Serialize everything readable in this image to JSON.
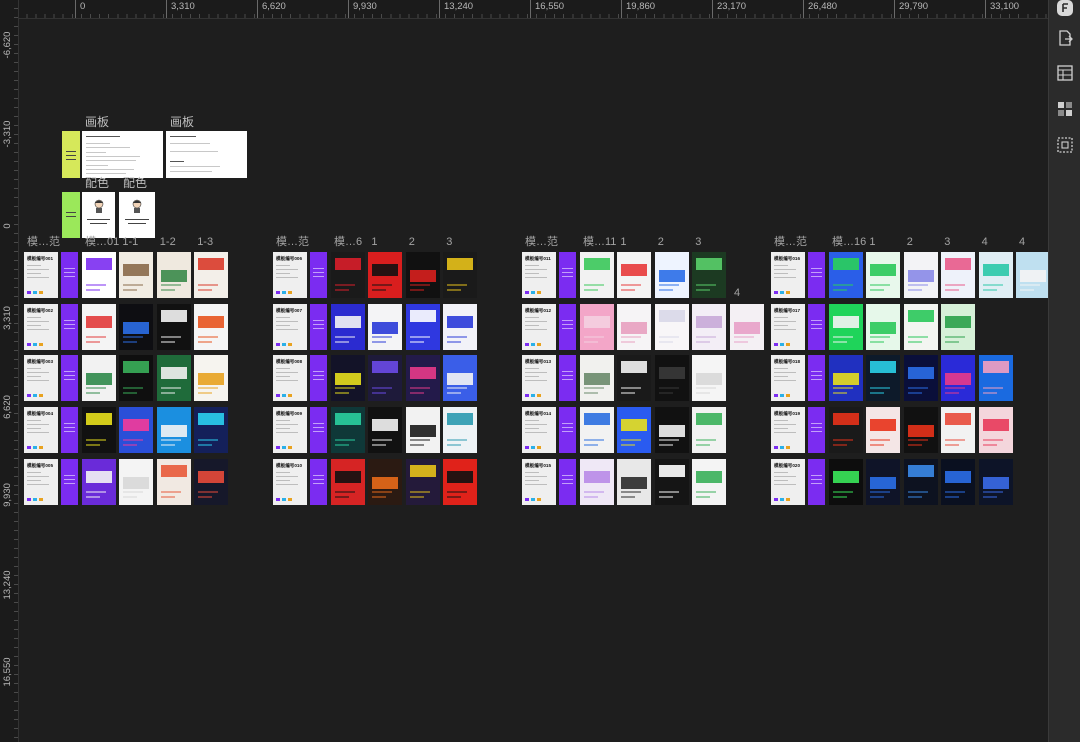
{
  "rulers": {
    "top": [
      "0",
      "3,310",
      "6,620",
      "9,930",
      "13,240",
      "16,550",
      "19,860",
      "23,170",
      "26,480",
      "29,790",
      "33,100"
    ],
    "left": [
      "-6,620",
      "-3,310",
      "0",
      "3,310",
      "6,620",
      "9,930",
      "13,240",
      "16,550"
    ]
  },
  "artboard_section": {
    "label_1": "画板",
    "label_2": "画板",
    "palette_label_1": "配色",
    "palette_label_2": "配色"
  },
  "colors": {
    "canvas": "#1e1e1e",
    "purple_bar": "#7b2cf1",
    "yellow_card": "#d6e85a",
    "green_card": "#9be85a",
    "toolbar": "#2b2b2b"
  },
  "toolbar_icons": [
    "app-logo-icon",
    "export-icon",
    "layout-icon",
    "grid-icon",
    "frame-icon"
  ],
  "groups": [
    {
      "labels": [
        "模…范",
        "模…01",
        "1-1",
        "1-2",
        "1-3"
      ],
      "rows": [
        {
          "title": "模板编号001",
          "thumbs": [
            [
              "#ffffff",
              "#7b2cf1"
            ],
            [
              "#f1ece3",
              "#8a6a4a"
            ],
            [
              "#efe9df",
              "#3a8a4a"
            ],
            [
              "#f3efe9",
              "#d93a2a"
            ]
          ]
        },
        {
          "title": "模板编号002",
          "thumbs": [
            [
              "#f4f4f4",
              "#e23a3a"
            ],
            [
              "#0e0e12",
              "#2b6ee8"
            ],
            [
              "#111111",
              "#f4f4f4"
            ],
            [
              "#f5f5f5",
              "#e8541f"
            ]
          ]
        },
        {
          "title": "模板编号003",
          "thumbs": [
            [
              "#f2f2f2",
              "#2f8a4a"
            ],
            [
              "#0f0f0f",
              "#3ab05a"
            ],
            [
              "#1f6b3a",
              "#f2f2f2"
            ],
            [
              "#f6f4ef",
              "#e8a21f"
            ]
          ]
        },
        {
          "title": "模板编号004",
          "thumbs": [
            [
              "#111111",
              "#e8e01c"
            ],
            [
              "#2a4fd8",
              "#f43a9a"
            ],
            [
              "#1b8fe0",
              "#f4f4f4"
            ],
            [
              "#14205a",
              "#2ad0f0"
            ]
          ]
        },
        {
          "title": "模板编号005",
          "thumbs": [
            [
              "#6a2bd9",
              "#f4f4f4"
            ],
            [
              "#f4f4f4",
              "#d8d8d8"
            ],
            [
              "#f1e9e2",
              "#e85a3a"
            ],
            [
              "#16182a",
              "#e84a3a"
            ]
          ]
        }
      ]
    },
    {
      "labels": [
        "模…范",
        "模…6",
        "1",
        "2",
        "3"
      ],
      "rows": [
        {
          "title": "模板编号006",
          "thumbs": [
            [
              "#1a1a1a",
              "#d91e2a"
            ],
            [
              "#d91e1e",
              "#111111"
            ],
            [
              "#111111",
              "#d8201e"
            ],
            [
              "#1a1a1a",
              "#e8c21a"
            ]
          ]
        },
        {
          "title": "模板编号007",
          "thumbs": [
            [
              "#2b2bd0",
              "#f4f4f4"
            ],
            [
              "#f4f4f6",
              "#2a3ad8"
            ],
            [
              "#2f38e0",
              "#ffffff"
            ],
            [
              "#f2f2f8",
              "#2a3ad8"
            ]
          ]
        },
        {
          "title": "模板编号008",
          "thumbs": [
            [
              "#131328",
              "#e8e01c"
            ],
            [
              "#1e1a3a",
              "#6a4ae8"
            ],
            [
              "#231a4a",
              "#e83a8a"
            ],
            [
              "#3a5ee8",
              "#f4f4f4"
            ]
          ]
        },
        {
          "title": "模板编号009",
          "thumbs": [
            [
              "#0f3838",
              "#2ad0a0"
            ],
            [
              "#111111",
              "#f4f4f4"
            ],
            [
              "#f2f2f2",
              "#1a1a1a"
            ],
            [
              "#eef3f6",
              "#2a9ab0"
            ]
          ]
        },
        {
          "title": "模板编号010",
          "thumbs": [
            [
              "#d62424",
              "#111111"
            ],
            [
              "#2b1a12",
              "#e86a1a"
            ],
            [
              "#241a3a",
              "#e8c21a"
            ],
            [
              "#e0221a",
              "#111111"
            ]
          ]
        }
      ]
    },
    {
      "labels": [
        "模…范",
        "模…11",
        "1",
        "2",
        "3"
      ],
      "rows": [
        {
          "title": "模板编号011",
          "thumbs": [
            [
              "#f2f2f2",
              "#3ac85a"
            ],
            [
              "#f4f4f4",
              "#e83a3a"
            ],
            [
              "#eef4ff",
              "#2a6ee8"
            ],
            [
              "#1c3a22",
              "#5ad06a"
            ]
          ]
        },
        {
          "title": "模板编号012",
          "extra_label": "4",
          "thumbs": [
            [
              "#f3a6c8",
              "#f4d0e0"
            ],
            [
              "#f6f4f6",
              "#e8a0c0"
            ],
            [
              "#f8f6f8",
              "#d8d8e8"
            ],
            [
              "#f3eef6",
              "#c8a8d8"
            ],
            [
              "#f4f0f4",
              "#e8a0c8"
            ]
          ]
        },
        {
          "title": "模板编号013",
          "thumbs": [
            [
              "#f1f1ee",
              "#6a8a6a"
            ],
            [
              "#1a1a1a",
              "#f4f4f4"
            ],
            [
              "#111111",
              "#3a3a3a"
            ],
            [
              "#f5f5f5",
              "#d8d8d8"
            ]
          ]
        },
        {
          "title": "模板编号014",
          "thumbs": [
            [
              "#f2f2f2",
              "#2a6ee0"
            ],
            [
              "#2a5bf0",
              "#e8e01c"
            ],
            [
              "#111111",
              "#f4f4f4"
            ],
            [
              "#f2f2f2",
              "#3ab05a"
            ]
          ]
        },
        {
          "title": "模板编号015",
          "thumbs": [
            [
              "#efe8f6",
              "#b88ae8"
            ],
            [
              "#e8e8e8",
              "#2a2a2a"
            ],
            [
              "#151515",
              "#ffffff"
            ],
            [
              "#f4f4f4",
              "#3ab05a"
            ]
          ]
        }
      ]
    },
    {
      "labels": [
        "模…范",
        "模…16",
        "1",
        "2",
        "3",
        "4",
        "4"
      ],
      "rows": [
        {
          "title": "模板编号016",
          "thumbs": [
            [
              "#2a5ee8",
              "#2ad05a"
            ],
            [
              "#e8f8ec",
              "#2ac85a"
            ],
            [
              "#f3f3f6",
              "#8a8ae8"
            ],
            [
              "#eef2fa",
              "#e85a8a"
            ],
            [
              "#e0eef4",
              "#2ac8a8"
            ],
            [
              "#bfe0f0",
              "#f4f4f4"
            ]
          ]
        },
        {
          "title": "模板编号017",
          "thumbs": [
            [
              "#1fd45a",
              "#f4f4f4"
            ],
            [
              "#e6f8ea",
              "#2ac85a"
            ],
            [
              "#f3f5f1",
              "#2ac85a"
            ],
            [
              "#d6f0d8",
              "#2aa04a"
            ]
          ]
        },
        {
          "title": "模板编号018",
          "thumbs": [
            [
              "#2030c0",
              "#e8e01c"
            ],
            [
              "#0d1a2a",
              "#2ad0e8"
            ],
            [
              "#0a0f3a",
              "#2a6ee8"
            ],
            [
              "#2a2ad8",
              "#e83a8a"
            ],
            [
              "#1a6ae0",
              "#f4a0c0"
            ]
          ]
        },
        {
          "title": "模板编号019",
          "thumbs": [
            [
              "#1a1a1a",
              "#e8321a"
            ],
            [
              "#f4e6e6",
              "#e8321a"
            ],
            [
              "#111111",
              "#e8321a"
            ],
            [
              "#f2f2f2",
              "#e84a3a"
            ],
            [
              "#f4d6dc",
              "#e83a5a"
            ]
          ]
        },
        {
          "title": "模板编号020",
          "thumbs": [
            [
              "#0d0d0d",
              "#3ae85a"
            ],
            [
              "#0f1428",
              "#2a6ee8"
            ],
            [
              "#0d1220",
              "#3a8ae8"
            ],
            [
              "#0a1020",
              "#2a6ee8"
            ],
            [
              "#0d1428",
              "#3a6ae8"
            ]
          ]
        }
      ]
    }
  ]
}
